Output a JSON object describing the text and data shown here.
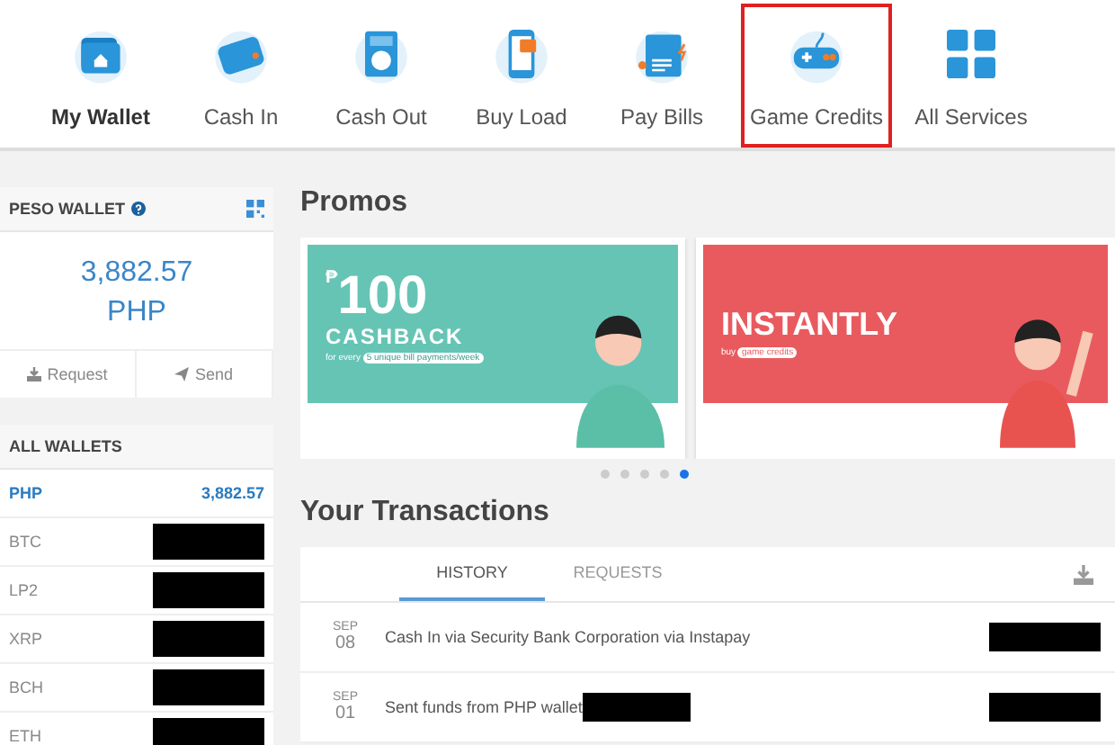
{
  "nav": [
    {
      "label": "My Wallet",
      "selected": true,
      "highlighted": false
    },
    {
      "label": "Cash In",
      "selected": false,
      "highlighted": false
    },
    {
      "label": "Cash Out",
      "selected": false,
      "highlighted": false
    },
    {
      "label": "Buy Load",
      "selected": false,
      "highlighted": false
    },
    {
      "label": "Pay Bills",
      "selected": false,
      "highlighted": false
    },
    {
      "label": "Game Credits",
      "selected": false,
      "highlighted": true
    },
    {
      "label": "All Services",
      "selected": false,
      "highlighted": false
    }
  ],
  "peso_wallet": {
    "title": "PESO WALLET",
    "amount": "3,882.57",
    "currency": "PHP",
    "actions": [
      "Request",
      "Send"
    ]
  },
  "all_wallets": {
    "title": "ALL WALLETS",
    "items": [
      {
        "currency": "PHP",
        "amount": "3,882.57",
        "selected": true,
        "redacted": false
      },
      {
        "currency": "BTC",
        "selected": false,
        "redacted": true
      },
      {
        "currency": "LP2",
        "selected": false,
        "redacted": true
      },
      {
        "currency": "XRP",
        "selected": false,
        "redacted": true
      },
      {
        "currency": "BCH",
        "selected": false,
        "redacted": true
      },
      {
        "currency": "ETH",
        "selected": false,
        "redacted": true
      }
    ]
  },
  "promos": {
    "title": "Promos",
    "banners": [
      {
        "kind": "cashback",
        "currency_sign": "₱",
        "headline": "100",
        "subhead": "CASHBACK",
        "note": "for every",
        "pill": "5 unique bill payments/week"
      },
      {
        "kind": "games",
        "headline": "INSTANTLY",
        "note": "buy",
        "pill": "game credits"
      }
    ],
    "dots": [
      {
        "selected": false
      },
      {
        "selected": false
      },
      {
        "selected": false
      },
      {
        "selected": false
      },
      {
        "selected": true
      }
    ]
  },
  "transactions": {
    "title": "Your Transactions",
    "tabs": [
      {
        "label": "HISTORY",
        "selected": true
      },
      {
        "label": "REQUESTS",
        "selected": false
      }
    ],
    "rows": [
      {
        "month": "SEP",
        "day": "08",
        "description": "Cash In via Security Bank Corporation via Instapay",
        "description_redacted": false,
        "amount_redacted": true
      },
      {
        "month": "SEP",
        "day": "01",
        "description": "Sent funds from PHP wallet",
        "description_redacted": true,
        "amount_redacted": true
      }
    ]
  }
}
